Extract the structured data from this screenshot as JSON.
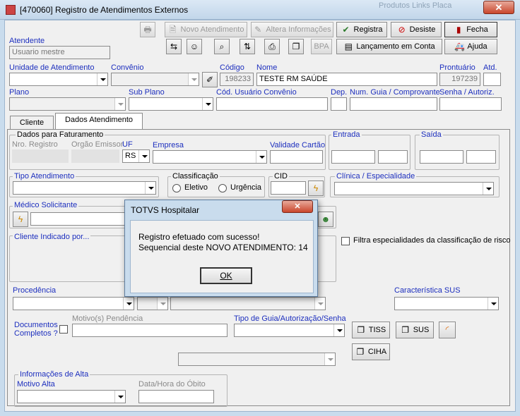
{
  "window": {
    "title": "[470060]   Registro de Atendimentos Externos",
    "close_label": "✕",
    "background_text": "Produtos   Links  Placa"
  },
  "toolbar": {
    "novo_atendimento": "Novo Atendimento",
    "altera_informacoes": "Altera Informações",
    "registra": "Registra",
    "desiste": "Desiste",
    "fecha": "Fecha",
    "bpa": "BPA",
    "lancamento_conta": "Lançamento em Conta",
    "ajuda": "Ajuda"
  },
  "header": {
    "atendente_label": "Atendente",
    "atendente_value": "Usuario mestre",
    "unidade_label": "Unidade de Atendimento",
    "convenio_label": "Convênio",
    "codigo_label": "Código",
    "codigo_value": "198233",
    "nome_label": "Nome",
    "nome_value": "TESTE RM SAÚDE",
    "prontuario_label": "Prontuário",
    "prontuario_value": "197239",
    "atd_label": "Atd.",
    "plano_label": "Plano",
    "subplano_label": "Sub Plano",
    "cod_usuario_label": "Cód. Usuário Convênio",
    "dep_label": "Dep.",
    "num_guia_label": "Num. Guia / Comprovante",
    "senha_label": "Senha / Autoriz."
  },
  "tabs": {
    "cliente": "Cliente",
    "dados": "Dados Atendimento"
  },
  "faturamento": {
    "group_label": "Dados para Faturamento",
    "nro_registro": "Nro. Registro",
    "orgao_emissor": "Orgão Emissor",
    "uf": "UF",
    "uf_value": "RS",
    "empresa": "Empresa",
    "validade": "Validade Cartão"
  },
  "entrada_label": "Entrada",
  "saida_label": "Saída",
  "tipo_atendimento_label": "Tipo Atendimento",
  "classificacao": {
    "label": "Classificação",
    "eletivo": "Eletivo",
    "urgencia": "Urgência"
  },
  "cid_label": "CID",
  "clinica_label": "Clínica / Especialidade",
  "medico_label": "Médico Solicitante",
  "cliente_indicado_label": "Cliente Indicado por...",
  "filtra_label": "Filtra especialidades da classificação de risco",
  "procedencia_label": "Procedência",
  "caracteristica_label": "Característica SUS",
  "documentos_label_1": "Documentos",
  "documentos_label_2": "Completos ?",
  "motivo_pendencia_label": "Motivo(s) Pendência",
  "tipo_guia_label": "Tipo de Guia/Autorização/Senha",
  "tiss": "TISS",
  "sus": "SUS",
  "ciha": "CIHA",
  "alta": {
    "group_label": "Informações de Alta",
    "motivo_label": "Motivo Alta",
    "data_obito_label": "Data/Hora do Óbito"
  },
  "dialog": {
    "title": "TOTVS Hospitalar",
    "close_label": "✕",
    "line1": "Registro efetuado com sucesso!",
    "line2": "Sequencial deste NOVO ATENDIMENTO: 14",
    "ok": "OK"
  }
}
